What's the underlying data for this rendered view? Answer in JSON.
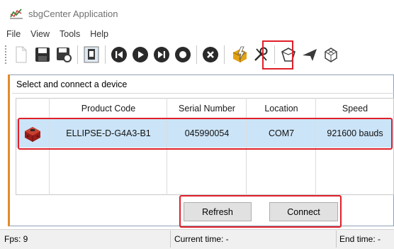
{
  "window": {
    "title": "sbgCenter Application"
  },
  "menu": [
    "File",
    "View",
    "Tools",
    "Help"
  ],
  "toolbar": {
    "buttons": [
      "new-file-icon",
      "save-icon",
      "save-config-icon",
      "import-icon",
      "prev-icon",
      "play-icon",
      "next-icon",
      "record-icon",
      "stop-icon",
      "connect-device-icon",
      "settings-tools-icon",
      "shape-icon",
      "airplane-icon",
      "cube-icon"
    ]
  },
  "dialog": {
    "title": "Select and connect a device",
    "columns": [
      "Product Code",
      "Serial Number",
      "Location",
      "Speed"
    ],
    "rows": [
      {
        "product_code": "ELLIPSE-D-G4A3-B1",
        "serial_number": "045990054",
        "location": "COM7",
        "speed": "921600 bauds"
      }
    ],
    "refresh_label": "Refresh",
    "connect_label": "Connect"
  },
  "status": {
    "fps": "Fps: 9",
    "current_time": "Current time: -",
    "end_time": "End time: -"
  },
  "colors": {
    "highlight": "#e0202a",
    "selection": "#cce4f7"
  }
}
